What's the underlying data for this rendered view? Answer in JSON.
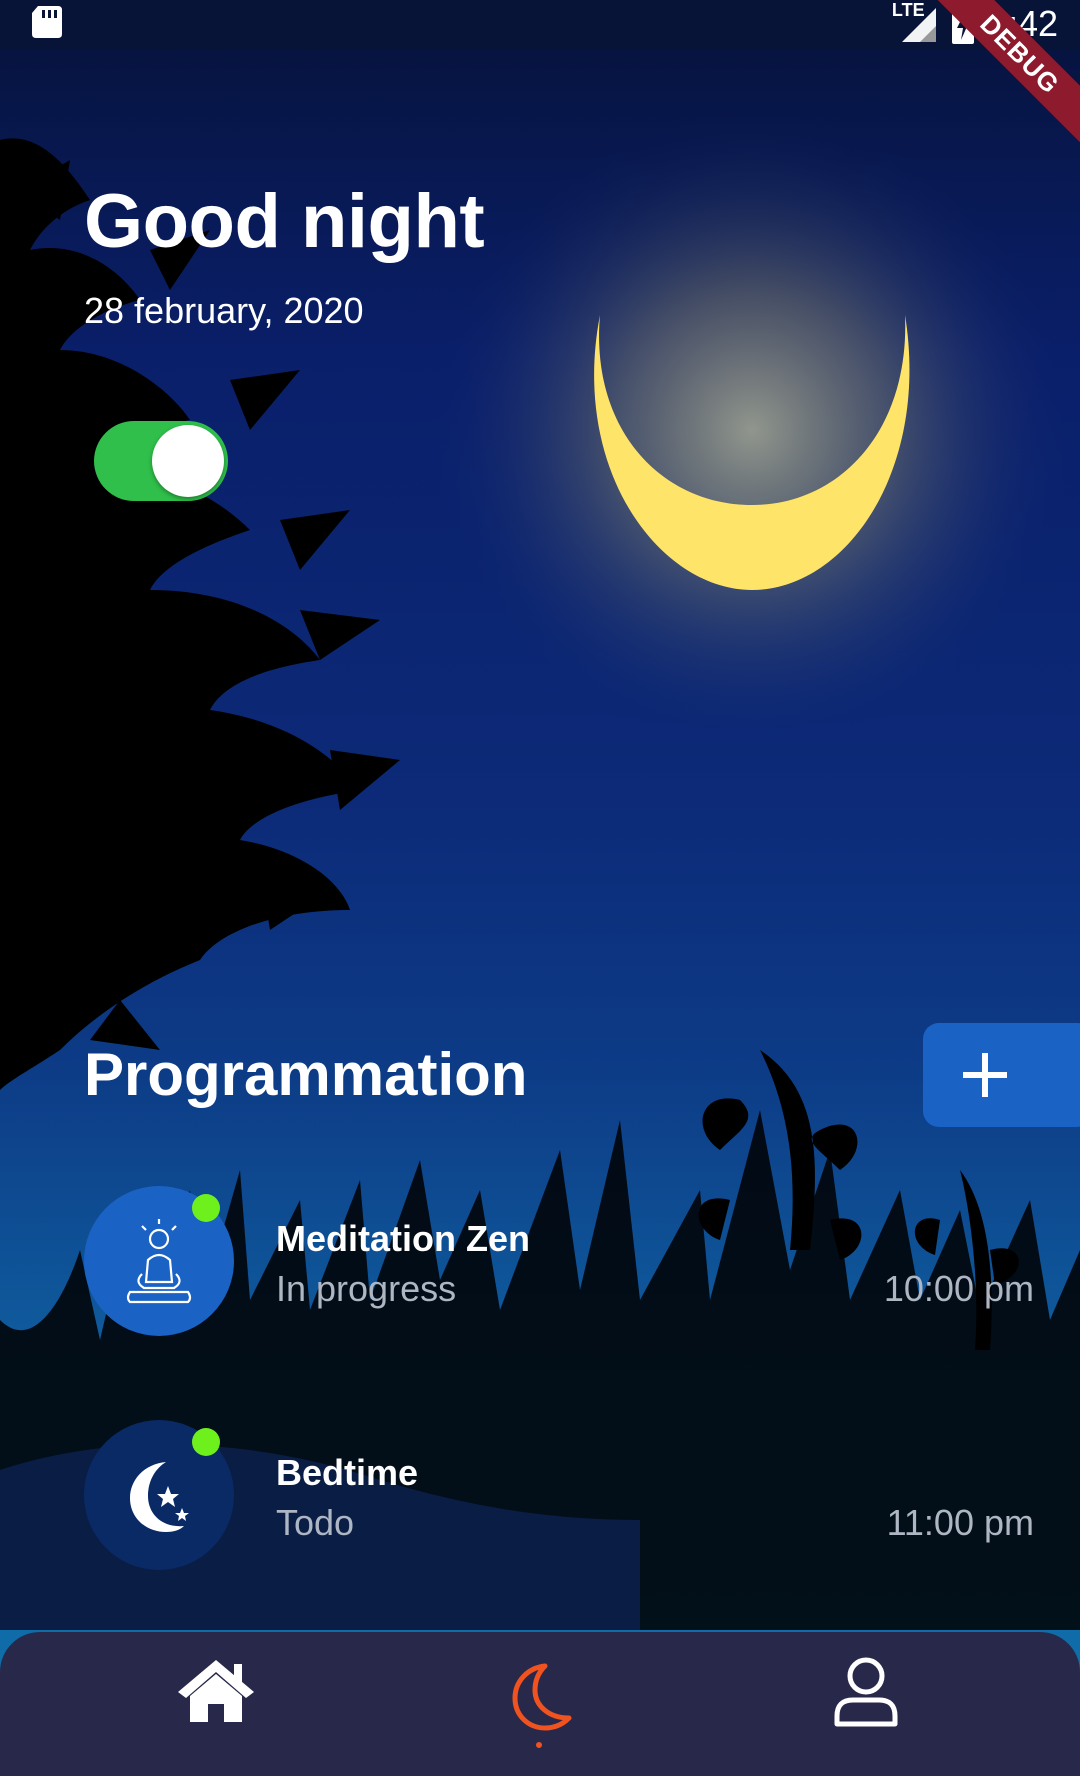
{
  "status_bar": {
    "time": "8:42",
    "network": "LTE",
    "icons": [
      "sd-card-icon",
      "signal-icon",
      "battery-charging-icon"
    ]
  },
  "debug_banner": "DEBUG",
  "header": {
    "greeting": "Good night",
    "date": "28 february, 2020"
  },
  "night_mode_toggle": {
    "on": true,
    "color": "#2fbf4a"
  },
  "programmation": {
    "title": "Programmation",
    "add_icon": "plus-icon",
    "items": [
      {
        "title": "Meditation Zen",
        "status": "In progress",
        "time": "10:00 pm",
        "icon": "meditation-icon",
        "avatar_color": "#1a63c4",
        "active": true
      },
      {
        "title": "Bedtime",
        "status": "Todo",
        "time": "11:00 pm",
        "icon": "moon-stars-icon",
        "avatar_color": "#0a2a66",
        "active": true
      }
    ]
  },
  "bottom_nav": {
    "items": [
      {
        "icon": "home-icon",
        "active": false
      },
      {
        "icon": "moon-icon",
        "active": true
      },
      {
        "icon": "profile-icon",
        "active": false
      }
    ],
    "active_color": "#f0531f"
  },
  "colors": {
    "accent_green": "#6ef01c",
    "moon": "#ffe46a",
    "nav_bg": "#28294a"
  }
}
